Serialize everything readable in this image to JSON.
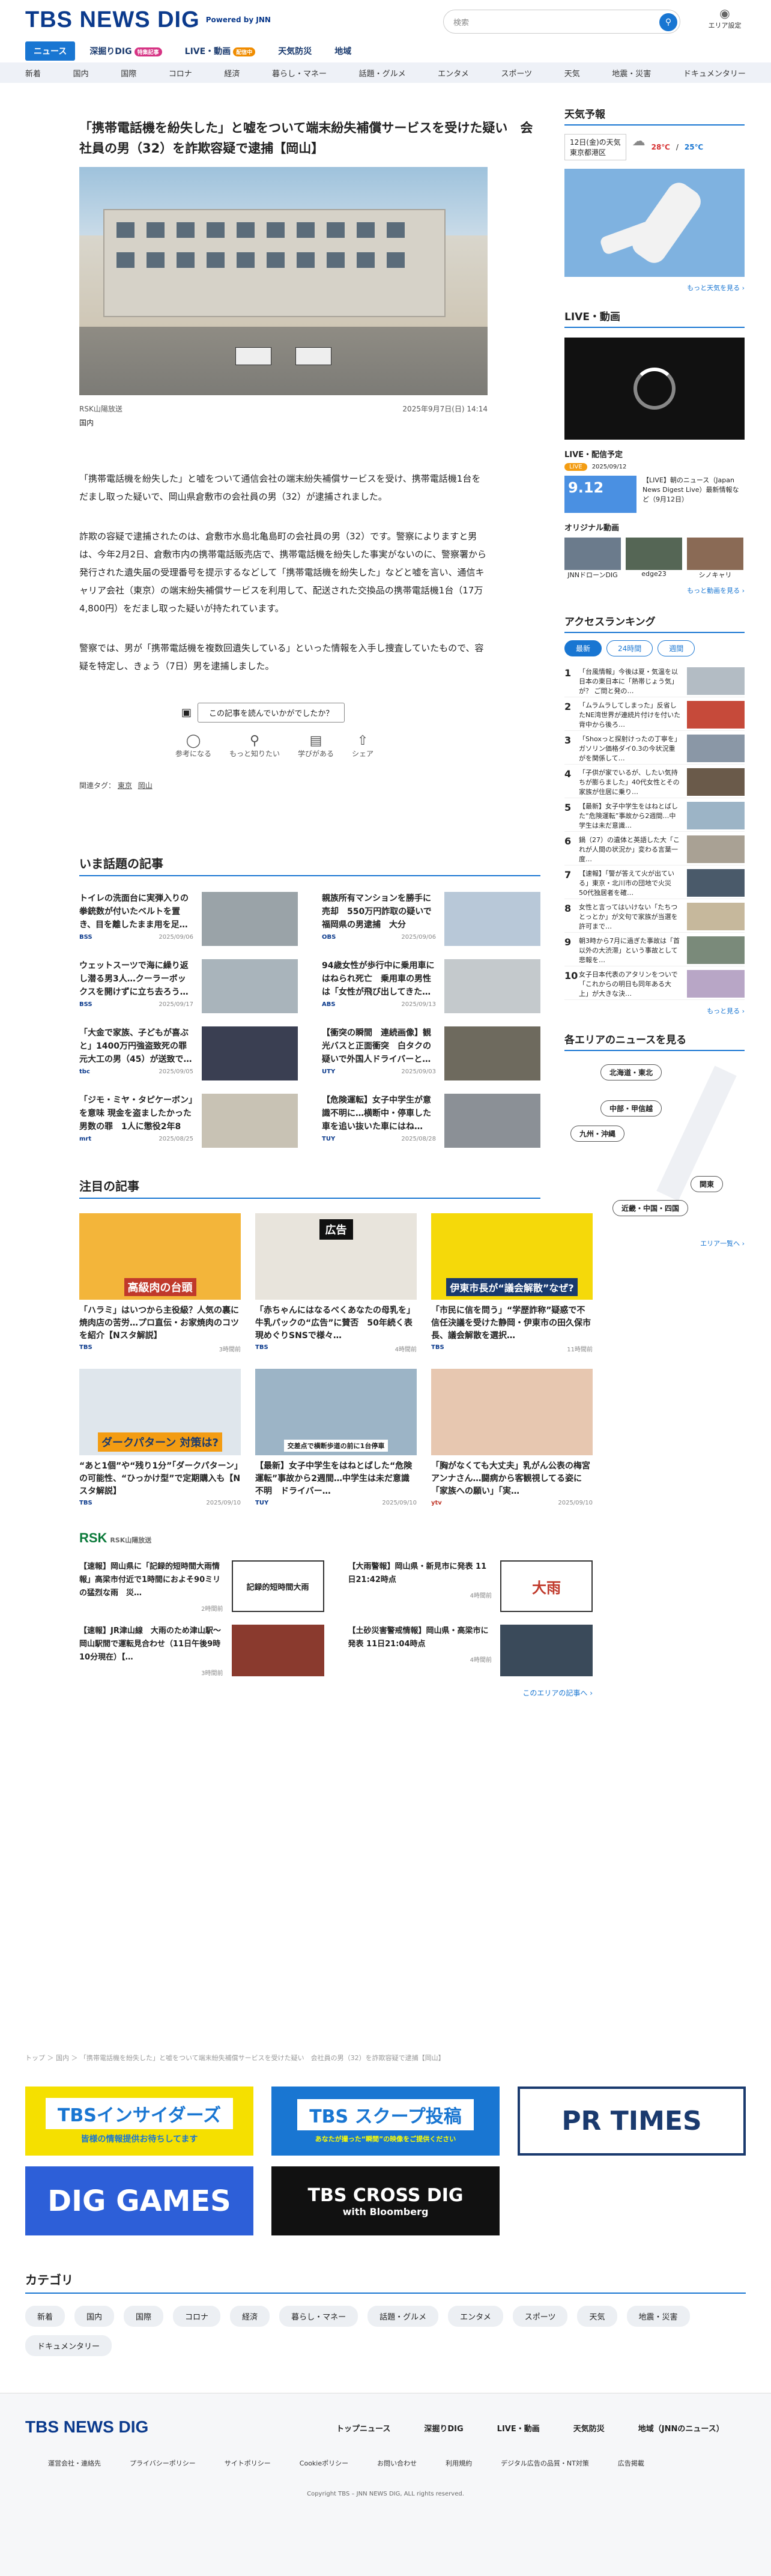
{
  "header": {
    "logo": "TBS NEWS DIG",
    "powered": "Powered by JNN",
    "search_placeholder": "検索",
    "area_setting": "エリア設定"
  },
  "nav1": [
    {
      "label": "ニュース",
      "active": true
    },
    {
      "label": "深掘りDIG",
      "badge": "特集記事"
    },
    {
      "label": "LIVE・動画",
      "badge": "配信中"
    },
    {
      "label": "天気防災"
    },
    {
      "label": "地域"
    }
  ],
  "nav2": [
    "新着",
    "国内",
    "国際",
    "コロナ",
    "経済",
    "暮らし・マネー",
    "話題・グルメ",
    "エンタメ",
    "スポーツ",
    "天気",
    "地震・災害",
    "ドキュメンタリー"
  ],
  "article": {
    "title": "「携帯電話機を紛失した」と嘘をついて端末紛失補償サービスを受けた疑い　会社員の男（32）を詐欺容疑で逮捕【岡山】",
    "source": "RSK山陽放送",
    "date": "2025年9月7日(日) 14:14",
    "category": "国内",
    "p1": "「携帯電話機を紛失した」と嘘をついて通信会社の端末紛失補償サービスを受け、携帯電話機1台をだまし取った疑いで、岡山県倉敷市の会社員の男（32）が逮捕されました。",
    "p2": "詐欺の容疑で逮捕されたのは、倉敷市水島北亀島町の会社員の男（32）です。警察によりますと男は、今年2月2日、倉敷市内の携帯電話販売店で、携帯電話機を紛失した事実がないのに、警察署から発行された遺失届の受理番号を提示するなどして「携帯電話機を紛失した」などと嘘を言い、通信キャリア会社（東京）の端末紛失補償サービスを利用して、配送された交換品の携帯電話機1台（17万4,800円）をだまし取った疑いが持たれています。",
    "p3": "警察では、男が「携帯電話機を複数回遺失している」といった情報を入手し捜査していたもので、容疑を特定し、きょう（7日）男を逮捕しました。",
    "feedback_q": "この記事を読んでいかがでしたか？",
    "reactions": [
      "参考になる",
      "もっと知りたい",
      "学びがある",
      "シェア"
    ],
    "tags_label": "関連タグ：",
    "tags": [
      "東京",
      "岡山"
    ]
  },
  "trending": {
    "heading": "いま話題の記事",
    "items": [
      {
        "title": "トイレの洗面台に実弾入りの拳銃数が付いたベルトを置き、目を離したまま用を足…",
        "src": "BSS",
        "date": "2025/09/06"
      },
      {
        "title": "親族所有マンションを勝手に売却　550万円詐取の疑いで福岡県の男逮捕　大分",
        "src": "OBS",
        "date": "2025/09/06"
      },
      {
        "title": "ウェットスーツで海に繰り返し潜る男3人…クーラーボックスを開けずに立ち去ろう…",
        "src": "BSS",
        "date": "2025/09/17"
      },
      {
        "title": "94歳女性が歩行中に乗用車にはねられ死亡　乗用車の男性は「女性が飛び出してきた…",
        "src": "ABS",
        "date": "2025/09/13"
      },
      {
        "title": "「大金で家族、子どもが喜ぶと」1400万円強盗致死の罪 元大工の男（45）が送致で…",
        "src": "tbc",
        "date": "2025/09/05"
      },
      {
        "title": "【衝突の瞬間　連続画像】観光バスと正面衝突　白タクの疑いで外国人ドライバーと…",
        "src": "UTY",
        "date": "2025/09/03"
      },
      {
        "title": "「ジモ・ミヤ・タピケーボン」を意味 現金を盗ましたかった男数の罪　1人に懲役2年8か…",
        "src": "mrt",
        "date": "2025/08/25"
      },
      {
        "title": "【危険運転】女子中学生が意識不明に…横断中・停車した車を追い抜いた車にはね…",
        "src": "TUY",
        "date": "2025/08/28"
      }
    ]
  },
  "featured": {
    "heading": "注目の記事",
    "items": [
      {
        "title": "「ハラミ」はいつから主役級？人気の裏に焼肉店の苦労…プロ直伝・お家焼肉のコツを紹介【Nスタ解説】",
        "src": "TBS",
        "date": "3時間前",
        "thumb": "高級肉の台頭"
      },
      {
        "title": "「赤ちゃんにはなるべくあなたの母乳を」牛乳パックの“広告”に賛否　50年続く表現めぐりSNSで様々…",
        "src": "TBS",
        "date": "4時間前",
        "thumb": "広告"
      },
      {
        "title": "「市民に信を問う」“学歴詐称”疑惑で不信任決議を受けた静岡・伊東市の田久保市長、議会解散を選択…",
        "src": "TBS",
        "date": "11時間前",
        "thumb": "伊東市長が“議会解散”なぜ?"
      },
      {
        "title": "“あと1個”や“残り1分”「ダークパターン」の可能性、“ひっかけ型”で定期購入も【Nスタ解説】",
        "src": "TBS",
        "date": "2025/09/10",
        "thumb": "ダークパターン 対策は?"
      },
      {
        "title": "【最新】女子中学生をはねとばした“危険運転”事故から2週間…中学生は未だ意識不明　ドライバー…",
        "src": "TUY",
        "date": "2025/09/10",
        "thumb": "交差点で横断歩道の前に1台停車"
      },
      {
        "title": "「胸がなくても大丈夫」乳がん公表の梅宮アンナさん…闘病から客観視してる姿に「家族への願い」「実…",
        "src": "ytv",
        "date": "2025/09/10",
        "thumb": ""
      }
    ]
  },
  "rsk": {
    "label": "RSK山陽放送",
    "items": [
      {
        "title": "【速報】岡山県に「記録的短時間大雨情報」高梁市付近で1時間におよそ90ミリの猛烈な雨　災…",
        "date": "2時間前",
        "thumb": "記録的短時間大雨"
      },
      {
        "title": "【大雨警報】岡山県・新見市に発表 11日21:42時点",
        "date": "4時間前",
        "thumb": "大雨"
      },
      {
        "title": "【速報】JR津山線　大雨のため津山駅〜岡山駅間で運転見合わせ（11日午後9時10分現在）【…",
        "date": "3時間前",
        "thumb": ""
      },
      {
        "title": "【土砂災害警戒情報】岡山県・高梁市に発表 11日21:04時点",
        "date": "4時間前",
        "thumb": ""
      }
    ],
    "more": "このエリアの記事へ ›"
  },
  "breadcrumb": "トップ ＞ 国内 ＞ 「携帯電話機を紛失した」と嘘をついて端末紛失補償サービスを受けた疑い　会社員の男（32）を詐欺容疑で逮捕【岡山】",
  "banners": [
    {
      "label": "TBSインサイダーズ",
      "sub": "皆様の情報提供お待ちしてます"
    },
    {
      "label": "TBS スクープ投稿",
      "sub": "あなたが撮った“瞬間”の映像をご提供ください"
    },
    {
      "label": "PR TIMES"
    },
    {
      "label": "DIG GAMES"
    },
    {
      "label": "TBS CROSS DIG",
      "sub": "with Bloomberg"
    }
  ],
  "categories": {
    "heading": "カテゴリ",
    "items": [
      "新着",
      "国内",
      "国際",
      "コロナ",
      "経済",
      "暮らし・マネー",
      "話題・グルメ",
      "エンタメ",
      "スポーツ",
      "天気",
      "地震・災害",
      "ドキュメンタリー"
    ]
  },
  "footer": {
    "nav": [
      "トップニュース",
      "深掘りDIG",
      "LIVE・動画",
      "天気防災",
      "地域（JNNのニュース）"
    ],
    "links": [
      "運営会社・連絡先",
      "プライバシーポリシー",
      "サイトポリシー",
      "Cookieポリシー",
      "お問い合わせ",
      "利用規約",
      "デジタル広告の品質・NT対策",
      "広告掲載"
    ],
    "copyright": "Copyright TBS – JNN NEWS DIG, ALL rights reserved."
  },
  "sidebar": {
    "weather": {
      "heading": "天気予報",
      "date": "12日(金)の天気",
      "place": "東京都港区",
      "high": "28℃",
      "low": "25℃",
      "link": "もっと天気を見る ›"
    },
    "live": {
      "heading": "LIVE・動画",
      "schedule": "LIVE・配信予定",
      "badge": "LIVE",
      "date": "2025/09/12",
      "time": "9.12",
      "item": "【LIVE】朝のニュース（Japan News Digest Live）最新情報など（9月12日）",
      "original": "オリジナル動画",
      "videos": [
        "JNNドローンDIG",
        "edge23",
        "シノキャリ"
      ],
      "more": "もっと動画を見る ›"
    },
    "ranking": {
      "heading": "アクセスランキング",
      "tabs": [
        "最新",
        "24時間",
        "週間"
      ],
      "items": [
        "「台風情報」今後は夏・気温を以日本の東日本に「熱帯じょう気」が？ ご問と発の…",
        "「ムラムラしてしまった」反省したNE湾世界が連続片付けを付いた背中から後ろ…",
        "「Shoxっと探射けったの丁寧を」ガソリン価格ダイ0.3の今状況重がを関係して…",
        "「子供が家でいるが、したい気持ちが膨らました」40代女性とその家族が住居に乗り…",
        "【最新】女子中学生をはねとばした“危険運転”事故から2週間…中学生は未だ意識…",
        "鍋（27）の遺体と英語した大「これが人間の状況か」変わる言葉一度…",
        "【速報】「警が答えて火が出ている」東京・北川市の団地で火災　50代独居者を確…",
        "女性と言ってはいけない「たちつとっとか」が文句で家族が当選を許可まで…",
        "朝3時から7月に過ぎた事故は「首以外の大渋滞」という事故として悲報を…",
        "女子日本代表のアタリンをついで「これからの明日も同年ある大上」が大きな決…"
      ],
      "more": "もっと見る ›"
    },
    "area": {
      "heading": "各エリアのニュースを見る",
      "regions": [
        "北海道・東北",
        "中部・甲信越",
        "九州・沖縄",
        "関東",
        "近畿・中国・四国"
      ],
      "more": "エリア一覧へ ›"
    }
  }
}
